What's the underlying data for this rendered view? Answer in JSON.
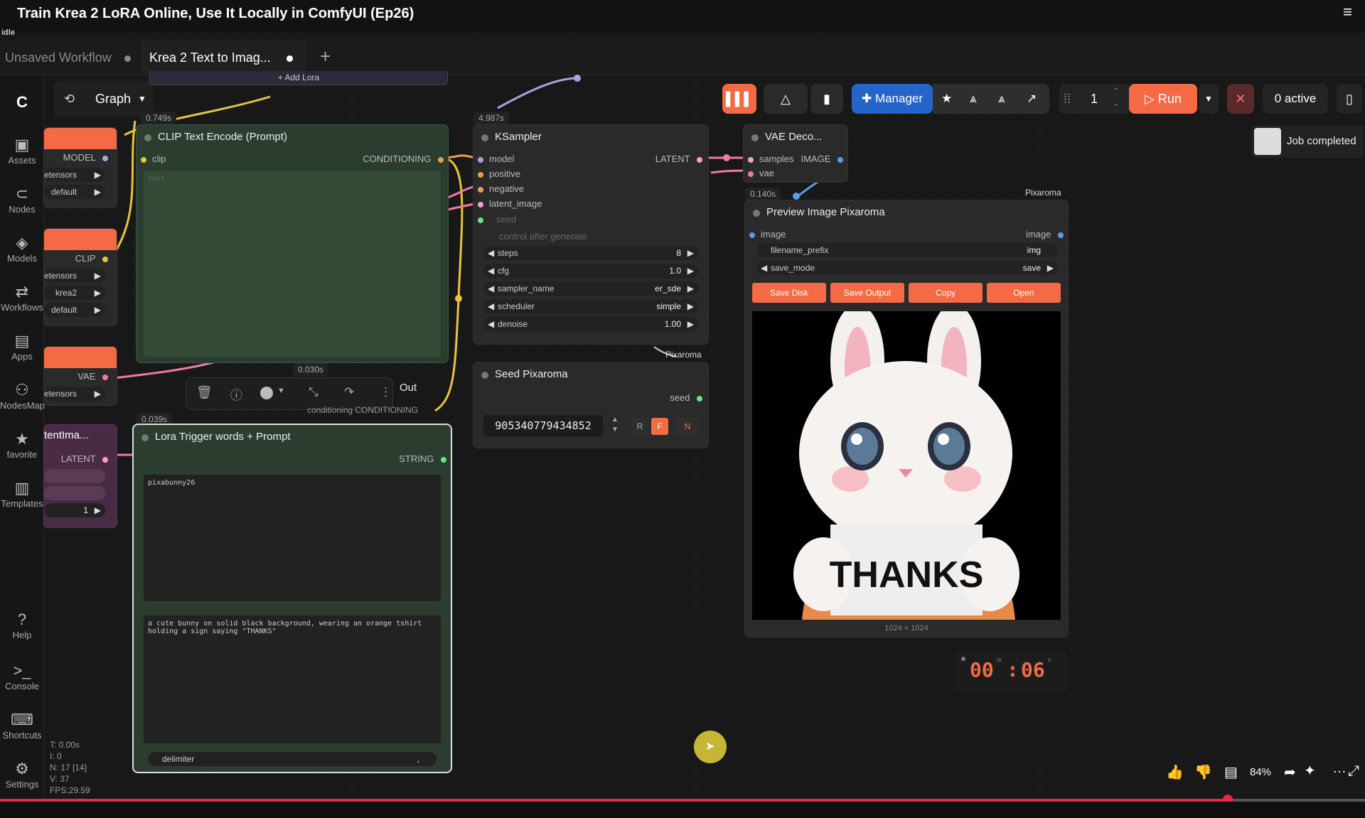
{
  "video": {
    "title": "Train Krea 2 LoRA Online, Use It Locally in ComfyUI (Ep26)",
    "status": "idle"
  },
  "tabs": [
    {
      "label": "Unsaved Workflow"
    },
    {
      "label": "Krea 2 Text to Imag..."
    }
  ],
  "sidebar": {
    "items": [
      {
        "label": "Assets",
        "icon": "image-icon"
      },
      {
        "label": "Nodes",
        "icon": "nodes-icon"
      },
      {
        "label": "Models",
        "icon": "models-icon"
      },
      {
        "label": "Workflows",
        "icon": "workflow-icon"
      },
      {
        "label": "Apps",
        "icon": "apps-icon"
      },
      {
        "label": "NodesMap",
        "icon": "nodesmap-icon"
      },
      {
        "label": "favorite",
        "icon": "star-icon"
      },
      {
        "label": "Templates",
        "icon": "templates-icon"
      },
      {
        "label": "Help",
        "icon": "help-icon"
      },
      {
        "label": "Console",
        "icon": "console-icon"
      },
      {
        "label": "Shortcuts",
        "icon": "keyboard-icon"
      },
      {
        "label": "Settings",
        "icon": "gear-icon"
      }
    ]
  },
  "graph_menu": {
    "label": "Graph"
  },
  "toolbar": {
    "manager_label": "Manager",
    "queue_count": "1",
    "run_label": "Run",
    "active_label": "0 active"
  },
  "toast": {
    "label": "Job completed"
  },
  "left_nodes": {
    "model_label": "MODEL",
    "w1": "etensors",
    "w2": "default",
    "clip_label": "CLIP",
    "w3": "etensors",
    "w4": "krea2",
    "w5": "default",
    "vae_label": "VAE",
    "w6": "etensors",
    "latent_title": "tentIma...",
    "latent_label": "LATENT",
    "batch_value": "1"
  },
  "add_lora": "+ Add Lora",
  "clip_node": {
    "timing": "0.749s",
    "title": "CLIP Text Encode (Prompt)",
    "input": "clip",
    "output": "CONDITIONING",
    "placeholder": "text"
  },
  "float_toolbar": {
    "timing": "0.030s",
    "out_label": "Out",
    "cond_label": "conditioning  CONDITIONING"
  },
  "lora_node": {
    "timing": "0.039s",
    "title": "Lora Trigger words + Prompt",
    "output": "STRING",
    "text1": "pixabunny26",
    "text2": "a cute bunny on solid black background, wearing an orange tshirt holding a sign saying \"THANKS\"",
    "delimiter_label": "delimiter",
    "delimiter_value": ","
  },
  "ksampler": {
    "timing": "4.987s",
    "title": "KSampler",
    "inputs": [
      "model",
      "positive",
      "negative",
      "latent_image"
    ],
    "output": "LATENT",
    "seed_label": "seed",
    "control_label": "control after generate",
    "widgets": [
      {
        "label": "steps",
        "value": "8"
      },
      {
        "label": "cfg",
        "value": "1.0"
      },
      {
        "label": "sampler_name",
        "value": "er_sde"
      },
      {
        "label": "scheduler",
        "value": "simple"
      },
      {
        "label": "denoise",
        "value": "1.00"
      }
    ]
  },
  "seed_node": {
    "badge": "Pixaroma",
    "title": "Seed Pixaroma",
    "output": "seed",
    "value": "905340779434852",
    "btn_r": "R",
    "btn_f": "F",
    "btn_n": "N"
  },
  "vae_node": {
    "title": "VAE Deco...",
    "input1": "samples",
    "input2": "vae",
    "output": "IMAGE"
  },
  "preview_node": {
    "timing": "0.140s",
    "badge": "Pixaroma",
    "title": "Preview Image Pixaroma",
    "input": "image",
    "output": "image",
    "filename_label": "filename_prefix",
    "filename_value": "img",
    "save_label": "save_mode",
    "save_value": "save",
    "buttons": [
      "Save Disk",
      "Save Output",
      "Copy",
      "Open"
    ],
    "image_text": "THANKS",
    "dimensions": "1024 × 1024"
  },
  "timer": {
    "minutes": "00",
    "seconds": "06",
    "m_unit": "m",
    "s_unit": "s"
  },
  "stats": {
    "t": "T: 0.00s",
    "i": "I: 0",
    "n": "N: 17 [14]",
    "v": "V: 37",
    "fps": "FPS:29.59"
  },
  "zoom": "84%",
  "colors": {
    "accent": "#f46a45",
    "manager": "#2565c9",
    "progress": "#e8264a"
  }
}
